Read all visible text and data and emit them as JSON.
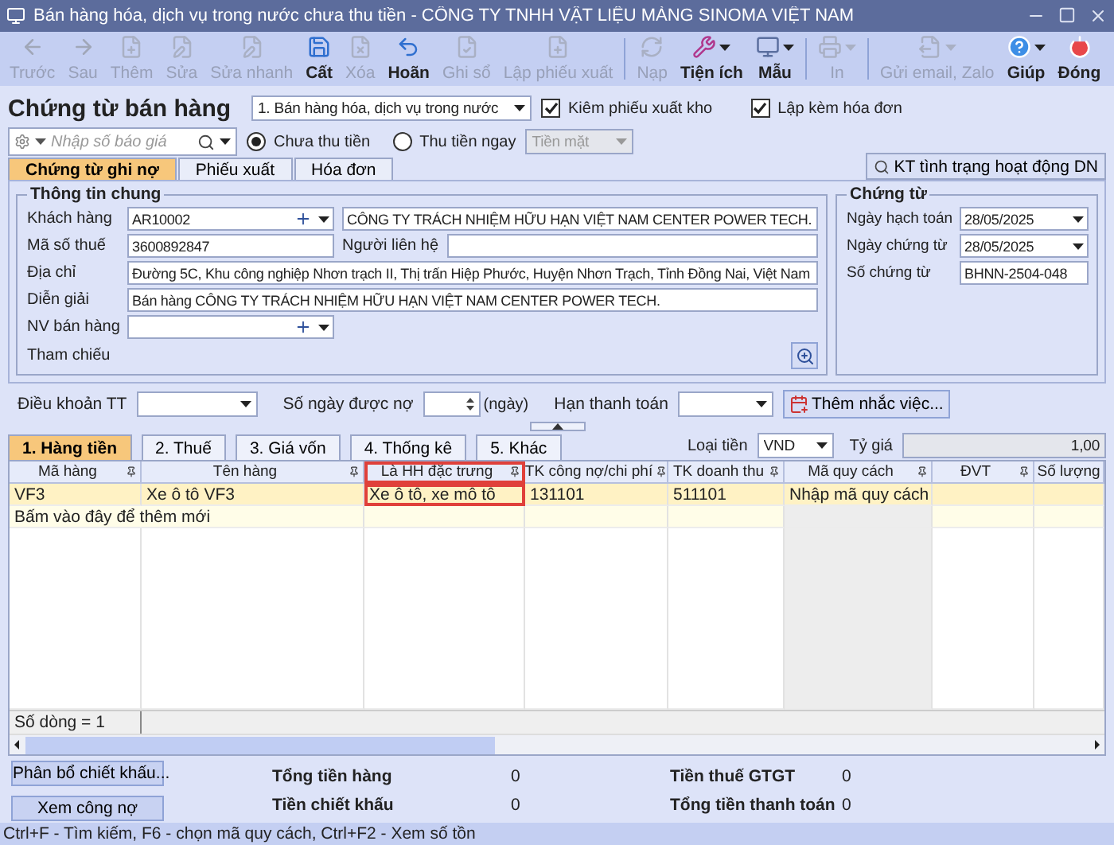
{
  "window": {
    "title": "Bán hàng hóa, dịch vụ trong nước chưa thu tiền - CÔNG TY TNHH VẬT LIỆU MÀNG SINOMA VIỆT NAM"
  },
  "toolbar_groups": [
    [
      {
        "label": "Trước",
        "kind": "back",
        "disabled": true,
        "dropdown": false
      },
      {
        "label": "Sau",
        "kind": "forward",
        "disabled": true,
        "dropdown": false
      },
      {
        "label": "Thêm",
        "kind": "add",
        "disabled": true,
        "dropdown": false
      },
      {
        "label": "Sửa",
        "kind": "edit",
        "disabled": true,
        "dropdown": false
      },
      {
        "label": "Sửa nhanh",
        "kind": "edit",
        "disabled": true,
        "dropdown": false
      },
      {
        "label": "Cất",
        "kind": "save",
        "disabled": false,
        "dropdown": false
      },
      {
        "label": "Xóa",
        "kind": "delete",
        "disabled": true,
        "dropdown": false
      },
      {
        "label": "Hoãn",
        "kind": "undo",
        "disabled": false,
        "dropdown": false
      },
      {
        "label": "Ghi sổ",
        "kind": "post",
        "disabled": true,
        "dropdown": false
      },
      {
        "label": "Lập phiếu xuất",
        "kind": "add",
        "disabled": true,
        "dropdown": false
      }
    ],
    [
      {
        "label": "Nạp",
        "kind": "reload",
        "disabled": true,
        "dropdown": false
      },
      {
        "label": "Tiện ích",
        "kind": "tools",
        "disabled": false,
        "dropdown": true
      },
      {
        "label": "Mẫu",
        "kind": "template",
        "disabled": false,
        "dropdown": true
      }
    ],
    [
      {
        "label": "In",
        "kind": "print",
        "disabled": true,
        "dropdown": true
      }
    ],
    [
      {
        "label": "Gửi email, Zalo",
        "kind": "send",
        "disabled": true,
        "dropdown": true
      },
      {
        "label": "Giúp",
        "kind": "help",
        "disabled": false,
        "dropdown": true
      },
      {
        "label": "Đóng",
        "kind": "close",
        "disabled": false,
        "dropdown": false
      }
    ]
  ],
  "header": {
    "title": "Chứng từ bán hàng",
    "voucher_type": "1. Bán hàng hóa, dịch vụ trong nước",
    "checkboxes": [
      {
        "label": "Kiêm phiếu xuất kho",
        "checked": true
      },
      {
        "label": "Lập kèm hóa đơn",
        "checked": true
      }
    ],
    "search": {
      "placeholder": "Nhập số báo giá"
    },
    "radios": [
      {
        "label": "Chưa thu tiền",
        "selected": true
      },
      {
        "label": "Thu tiền ngay",
        "selected": false
      }
    ],
    "payment_method": {
      "value": "Tiền mặt",
      "disabled": true
    }
  },
  "doc_tabs": [
    {
      "label": "Chứng từ ghi nợ",
      "selected": true
    },
    {
      "label": "Phiếu xuất",
      "selected": false
    },
    {
      "label": "Hóa đơn",
      "selected": false
    }
  ],
  "check_button": "KT tình trạng hoạt động DN",
  "general_info": {
    "title": "Thông tin chung",
    "customer": {
      "label": "Khách hàng",
      "code": "AR10002",
      "name": "CÔNG TY TRÁCH NHIỆM HỮU HẠN VIỆT NAM CENTER POWER TECH."
    },
    "tax_code": {
      "label": "Mã số thuế",
      "value": "3600892847"
    },
    "contact": {
      "label": "Người liên hệ"
    },
    "address": {
      "label": "Địa chỉ",
      "value": "Đường 5C, Khu công nghiệp Nhơn trạch II, Thị trấn Hiệp Phước, Huyện Nhơn Trạch, Tỉnh Đồng Nai, Việt Nam"
    },
    "description": {
      "label": "Diễn giải",
      "value": "Bán hàng CÔNG TY TRÁCH NHIỆM HỮU HẠN VIỆT NAM CENTER POWER TECH."
    },
    "salesperson": {
      "label": "NV bán hàng"
    },
    "reference": {
      "label": "Tham chiếu"
    }
  },
  "voucher": {
    "title": "Chứng từ",
    "fields": [
      {
        "label": "Ngày hạch toán",
        "value": "28/05/2025",
        "kind": "date"
      },
      {
        "label": "Ngày chứng từ",
        "value": "28/05/2025",
        "kind": "date"
      },
      {
        "label": "Số chứng từ",
        "value": "BHNN-2504-048",
        "kind": "text"
      }
    ]
  },
  "terms": [
    {
      "label": "Điều khoản TT",
      "kind": "select"
    },
    {
      "label": "Số ngày được nợ",
      "kind": "spin",
      "suffix": "(ngày)"
    },
    {
      "label": "Hạn thanh toán",
      "kind": "select"
    }
  ],
  "reminder_button": "Thêm nhắc việc...",
  "grid_tabs": [
    {
      "label": "1. Hàng tiền",
      "selected": true
    },
    {
      "label": "2. Thuế",
      "selected": false
    },
    {
      "label": "3. Giá vốn",
      "selected": false
    },
    {
      "label": "4. Thống kê",
      "selected": false
    },
    {
      "label": "5. Khác",
      "selected": false
    }
  ],
  "currency": {
    "label": "Loại tiền",
    "value": "VND"
  },
  "rate": {
    "label": "Tỷ giá",
    "value": "1,00"
  },
  "table": {
    "columns": [
      {
        "label": "Mã hàng",
        "pinned": true,
        "highlighted": false
      },
      {
        "label": "Tên hàng",
        "pinned": true,
        "highlighted": false
      },
      {
        "label": "Là HH đặc trưng",
        "pinned": true,
        "highlighted": true
      },
      {
        "label": "TK công nợ/chi phí",
        "pinned": true,
        "highlighted": false
      },
      {
        "label": "TK doanh thu",
        "pinned": true,
        "highlighted": false
      },
      {
        "label": "Mã quy cách",
        "pinned": true,
        "highlighted": false
      },
      {
        "label": "ĐVT",
        "pinned": true,
        "highlighted": false
      },
      {
        "label": "Số lượng",
        "pinned": false,
        "highlighted": false
      }
    ],
    "rows": [
      [
        "VF3",
        "Xe ô tô VF3",
        "Xe ô tô, xe mô tô",
        "131101",
        "511101",
        "Nhập mã quy cách"
      ]
    ],
    "new_row_hint": "Bấm vào đây để thêm mới",
    "row_count": "Số dòng = 1"
  },
  "footer_buttons": [
    "Phân bổ chiết khấu...",
    "Xem công nợ"
  ],
  "totals": [
    {
      "label": "Tổng tiền hàng",
      "value": "0"
    },
    {
      "label": "Tiền chiết khấu",
      "value": "0"
    },
    {
      "label": "Tiền thuế GTGT",
      "value": "0"
    },
    {
      "label": "Tổng tiền thanh toán",
      "value": "0"
    }
  ],
  "status_bar": "Ctrl+F - Tìm kiếm, F6 - chọn mã quy cách, Ctrl+F2 - Xem số tồn"
}
